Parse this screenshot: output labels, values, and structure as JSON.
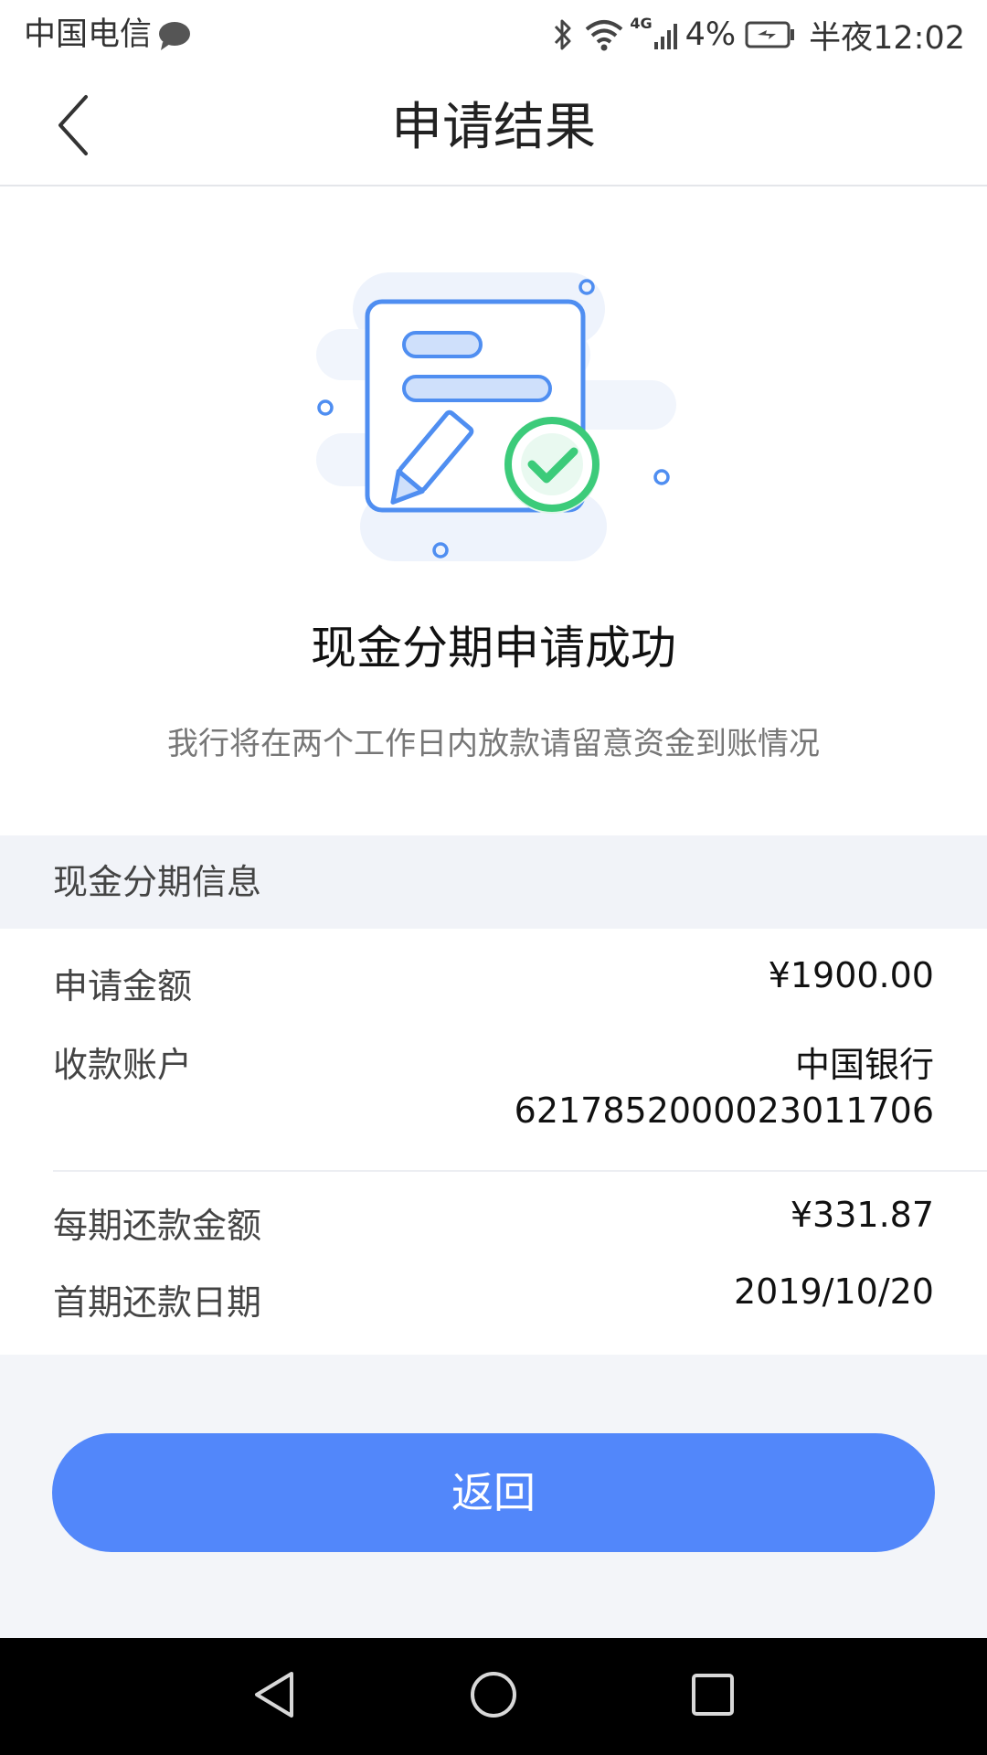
{
  "status_bar": {
    "carrier": "中国电信",
    "network": "4G",
    "battery": "4%",
    "time": "半夜12:02"
  },
  "header": {
    "title": "申请结果"
  },
  "result": {
    "title": "现金分期申请成功",
    "subtitle": "我行将在两个工作日内放款请留意资金到账情况"
  },
  "info": {
    "section_title": "现金分期信息",
    "rows": [
      {
        "label": "申请金额",
        "value": "¥1900.00"
      },
      {
        "label": "收款账户",
        "value_bank": "中国银行",
        "value_account": "6217852000023011706"
      },
      {
        "label": "每期还款金额",
        "value": "¥331.87"
      },
      {
        "label": "首期还款日期",
        "value": "2019/10/20"
      }
    ]
  },
  "actions": {
    "return_label": "返回"
  },
  "colors": {
    "accent": "#5287fa",
    "success": "#3ccb7a",
    "page_background": "#f3f5f9"
  },
  "icons": {
    "back": "chevron-left-icon",
    "success": "check-circle-icon",
    "nav_back": "triangle-back-icon",
    "nav_home": "circle-home-icon",
    "nav_recents": "square-recents-icon"
  }
}
